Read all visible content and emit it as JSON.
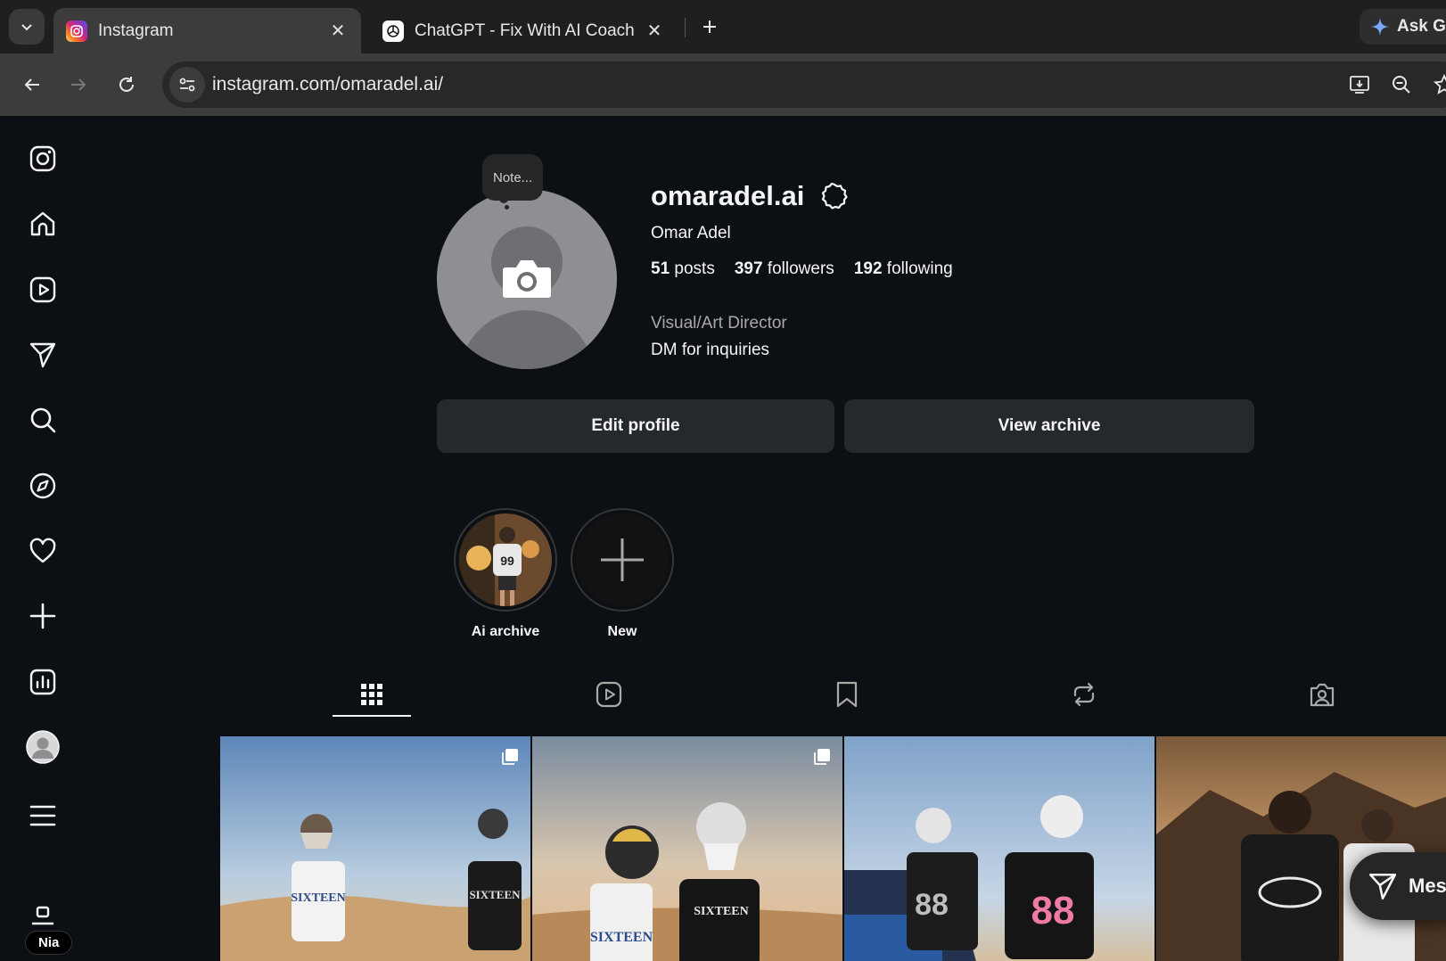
{
  "browser": {
    "tabs": [
      {
        "title": "Instagram",
        "active": true,
        "close": "✕"
      },
      {
        "title": "ChatGPT - Fix With AI Coach",
        "active": false,
        "close": "✕"
      }
    ],
    "new_tab": "+",
    "ask_button": "Ask G",
    "url": "instagram.com/omaradel.ai/"
  },
  "profile": {
    "note": "Note...",
    "username": "omaradel.ai",
    "full_name": "Omar Adel",
    "stats": {
      "posts_count": "51",
      "posts_label": "posts",
      "followers_count": "397",
      "followers_label": "followers",
      "following_count": "192",
      "following_label": "following"
    },
    "category": "Visual/Art Director",
    "bio": "DM for inquiries",
    "edit_button": "Edit profile",
    "archive_button": "View archive"
  },
  "highlights": [
    {
      "label": "Ai archive"
    },
    {
      "label": "New"
    }
  ],
  "profile_tabs": [
    "posts-grid",
    "reels",
    "saved",
    "reposts",
    "tagged"
  ],
  "sidebar": {
    "items": [
      "instagram-logo",
      "home",
      "reels",
      "messages",
      "search",
      "explore",
      "notifications",
      "create",
      "dashboard",
      "profile",
      "more",
      "threads"
    ],
    "user_pill": "Nia"
  },
  "messages_float": "Mes",
  "colors": {
    "background": "#0c1014",
    "button": "#25292e",
    "text": "#f5f5f5",
    "muted": "#a8a8a8",
    "chrome_dark": "#1f1f1f",
    "chrome_mid": "#3c3c3c"
  }
}
